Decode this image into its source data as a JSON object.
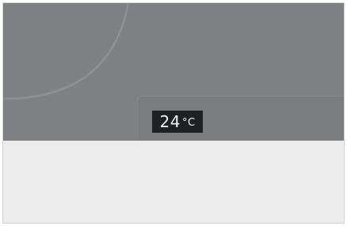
{
  "display": {
    "temperature": {
      "value": "24",
      "unit": "°C"
    }
  },
  "colors": {
    "display_background": "#7f8083",
    "badge_background": "#1f2022",
    "content_background": "#ececec"
  }
}
